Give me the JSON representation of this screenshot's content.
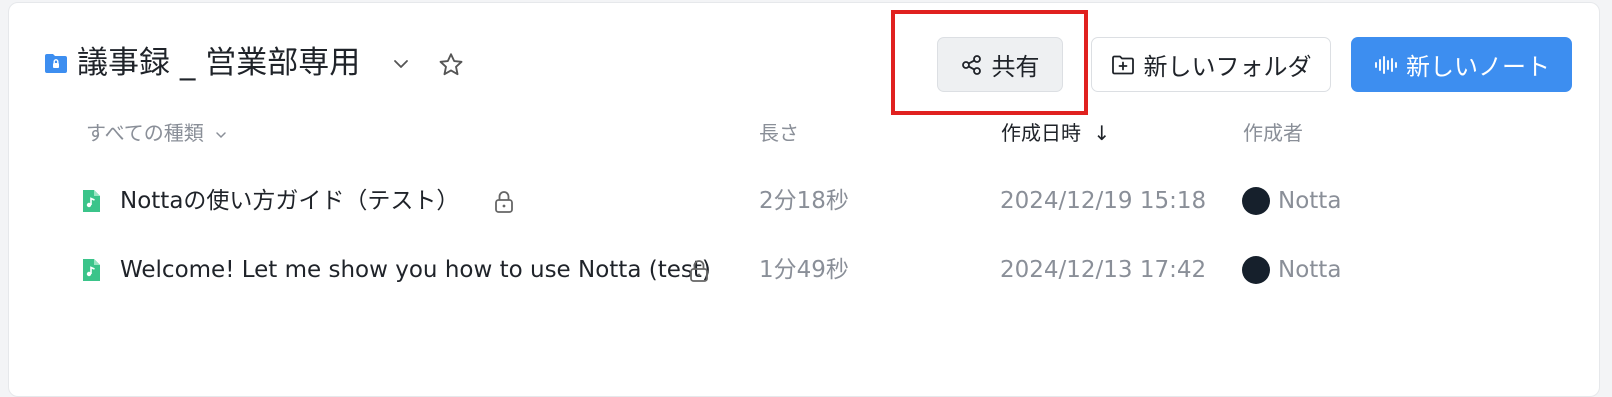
{
  "folder": {
    "title": "議事録 _ 営業部専用",
    "icon": "locked-folder-icon"
  },
  "toolbar": {
    "share_label": "共有",
    "new_folder_label": "新しいフォルダ",
    "new_note_label": "新しいノート",
    "accent_color": "#3d8ef0",
    "highlight_color": "#e0211f"
  },
  "table": {
    "headers": {
      "type_filter": "すべての種類",
      "length": "長さ",
      "created": "作成日時",
      "creator": "作成者"
    },
    "sort_indicator": "↓",
    "rows": [
      {
        "name": "Nottaの使い方ガイド（テスト）",
        "length": "2分18秒",
        "created": "2024/12/19 15:18",
        "creator": "Notta"
      },
      {
        "name": "Welcome! Let me show you how to use Notta (test)",
        "length": "1分49秒",
        "created": "2024/12/13 17:42",
        "creator": "Notta"
      }
    ]
  }
}
